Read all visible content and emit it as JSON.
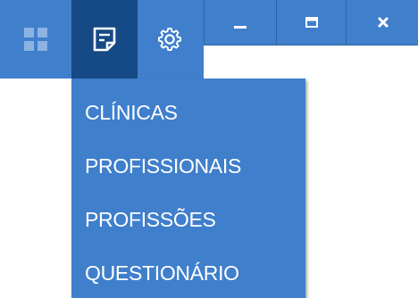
{
  "toolbar": {
    "dashboard_icon": "grid-icon",
    "forms_icon": "form-icon",
    "settings_icon": "gear-icon"
  },
  "window_controls": {
    "minimize_icon": "minimize-icon",
    "maximize_icon": "maximize-icon",
    "close_icon": "close-icon"
  },
  "menu": {
    "items": [
      {
        "label": "CLÍNICAS"
      },
      {
        "label": "PROFISSIONAIS"
      },
      {
        "label": "PROFISSÕES"
      },
      {
        "label": "QUESTIONÁRIO"
      }
    ]
  },
  "colors": {
    "bar_blue": "#3f7fcc",
    "active_tab": "#164a86",
    "dashboard_icon_color": "#8db3e2",
    "text": "#ffffff"
  }
}
